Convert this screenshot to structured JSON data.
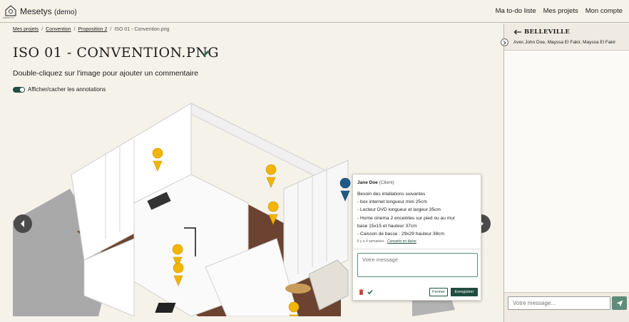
{
  "app": {
    "name": "Mesetys",
    "demo_label": "(demo)",
    "logo_sub": "MESETYS"
  },
  "nav": {
    "todo": "Ma to-do liste",
    "projects": "Mes projets",
    "account": "Mon compte"
  },
  "breadcrumb": [
    {
      "label": "Mes projets"
    },
    {
      "label": "Convention"
    },
    {
      "label": "Proposition 2"
    },
    {
      "label": "ISO 01 - Convention.png"
    }
  ],
  "page": {
    "title": "ISO 01 - CONVENTION.PNG",
    "subtitle": "Double-cliquez sur l'image pour ajouter un commentaire",
    "toggle_label": "Afficher/cacher les annotations",
    "toggle_on": true
  },
  "colors": {
    "accent": "#1f4d3f",
    "marker_yellow": "#f2b500",
    "marker_blue": "#1f5a87",
    "background": "#f5f2ea"
  },
  "markers": [
    {
      "color": "yellow"
    },
    {
      "color": "yellow"
    },
    {
      "color": "yellow"
    },
    {
      "color": "yellow"
    },
    {
      "color": "yellow"
    },
    {
      "color": "yellow"
    },
    {
      "color": "blue",
      "active": true
    }
  ],
  "comment": {
    "author": "Jane Doe",
    "role": "(Client)",
    "lines": [
      "Besoin des intallations suivantes",
      "- box internet longueur mini 25cm",
      "- Lecteur DVD longueur et largeur 35cm",
      "- Home cinema 2 enceintes sur pied ou au mur",
      "base 15x15 et hauteur 37cm",
      "- Caisson de basse : 29x29 hauteur 38cm"
    ],
    "time": "Il y a 4 semaines -",
    "convert_link": "Convertir en tâche",
    "reply_placeholder": "Votre message",
    "close_label": "Fermer",
    "save_label": "Enregistrer",
    "icons": [
      "trash-icon",
      "check-icon"
    ]
  },
  "panel": {
    "title": "BELLEVILLE",
    "participants": "Avec John Doe, Mayssa El Fakir, Mayssa El Fakir",
    "input_placeholder": "Votre message...",
    "send_icon": "send-icon"
  }
}
